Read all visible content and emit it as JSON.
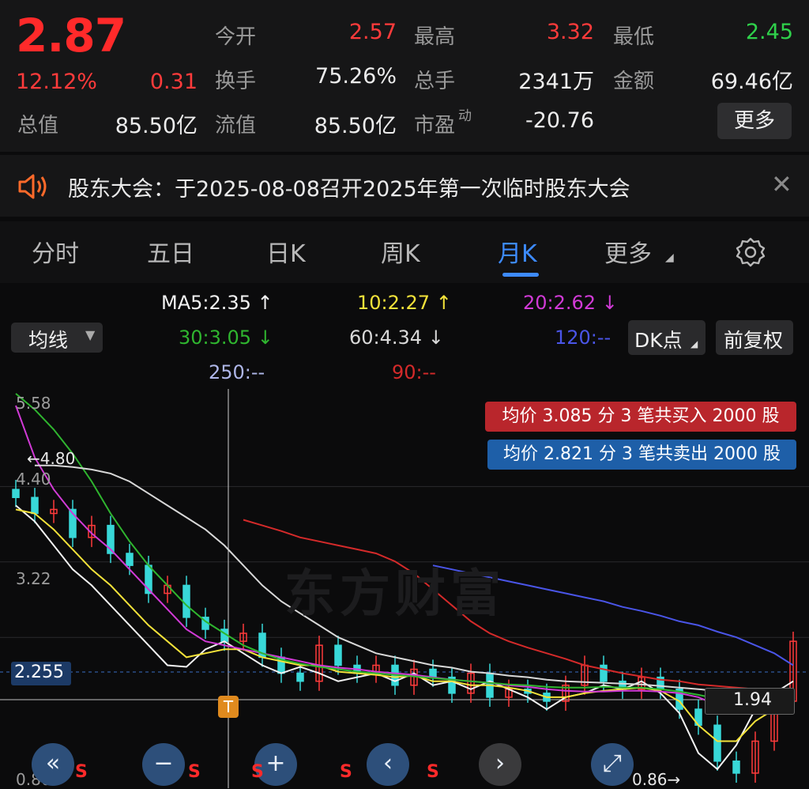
{
  "quote": {
    "price": "2.87",
    "change_pct": "12.12%",
    "change": "0.31",
    "rows": [
      [
        {
          "label": "今开",
          "value": "2.57",
          "tone": "up"
        },
        {
          "label": "最高",
          "value": "3.32",
          "tone": "up"
        },
        {
          "label": "最低",
          "value": "2.45",
          "tone": "dn"
        }
      ],
      [
        {
          "label": "换手",
          "value": "75.26%",
          "tone": ""
        },
        {
          "label": "总手",
          "value": "2341万",
          "tone": ""
        },
        {
          "label": "金额",
          "value": "69.46亿",
          "tone": ""
        }
      ],
      [
        {
          "label": "总值",
          "value": "85.50亿",
          "tone": ""
        },
        {
          "label": "流值",
          "value": "85.50亿",
          "tone": ""
        },
        {
          "label": "市盈",
          "sup": "动",
          "value": "-20.76",
          "tone": ""
        }
      ]
    ],
    "more_label": "更多"
  },
  "notice": {
    "text": "股东大会：于2025-08-08召开2025年第一次临时股东大会",
    "icon": "speaker-icon"
  },
  "tabs": [
    {
      "label": "分时",
      "active": false
    },
    {
      "label": "五日",
      "active": false
    },
    {
      "label": "日K",
      "active": false
    },
    {
      "label": "周K",
      "active": false
    },
    {
      "label": "月K",
      "active": true
    },
    {
      "label": "更多",
      "active": false
    }
  ],
  "settings_icon": "gear-icon",
  "ma_selector": "均线",
  "ma_legend": [
    {
      "text": "MA5:2.35 ↑",
      "color": "#f2f2f2"
    },
    {
      "text": "10:2.27 ↑",
      "color": "#f3e23a"
    },
    {
      "text": "20:2.62 ↓",
      "color": "#d13ad6"
    },
    {
      "text": "30:3.05 ↓",
      "color": "#2fb52f"
    },
    {
      "text": "60:4.34 ↓",
      "color": "#d8d8d8"
    },
    {
      "text": "120:--",
      "color": "#4a55e8"
    },
    {
      "text": "250:--",
      "color": "#aeb6e8"
    },
    {
      "text": "90:--",
      "color": "#d42a2a"
    }
  ],
  "dk_button": "DK点",
  "fq_button": "前复权",
  "chart_notes": {
    "buy": "均价 3.085 分 3 笔共买入 2000 股",
    "sell": "均价 2.821 分 3 笔共卖出 2000 股"
  },
  "watermark": "东方财富",
  "chart_data": {
    "type": "line",
    "y_labels": [
      "5.58",
      "4.40",
      "3.22",
      "2.255",
      "0.86"
    ],
    "max_label": "4.80",
    "min_label": "0.86",
    "cursor_value": "2.255",
    "right_value": "1.94",
    "t_marker": "T",
    "s_marks": [
      "S",
      "S",
      "S",
      "S",
      "S"
    ],
    "series": [
      {
        "color": "#f2f2f2",
        "values": [
          4.3,
          4.1,
          3.8,
          3.5,
          3.3,
          3.05,
          2.8,
          2.55,
          2.3,
          2.28,
          2.5,
          2.6,
          2.45,
          2.3,
          2.2,
          2.28,
          2.2,
          2.1,
          2.15,
          2.2,
          2.1,
          2.2,
          2.05,
          2.1,
          2.0,
          2.1,
          2.0,
          1.9,
          1.75,
          1.9,
          1.95,
          2.05,
          2.0,
          2.1,
          1.95,
          1.7,
          1.2,
          1.0,
          1.3,
          1.75,
          1.95,
          2.1
        ]
      },
      {
        "color": "#f3e23a",
        "values": [
          4.25,
          4.2,
          4.0,
          3.75,
          3.5,
          3.3,
          3.05,
          2.8,
          2.6,
          2.4,
          2.45,
          2.5,
          2.5,
          2.4,
          2.35,
          2.3,
          2.3,
          2.22,
          2.2,
          2.18,
          2.15,
          2.17,
          2.1,
          2.1,
          2.05,
          2.05,
          2.02,
          1.98,
          1.9,
          1.9,
          1.95,
          1.98,
          2.0,
          2.02,
          1.98,
          1.85,
          1.55,
          1.35,
          1.35,
          1.6,
          1.75,
          1.9
        ]
      },
      {
        "color": "#d13ad6",
        "values": [
          5.55,
          4.9,
          4.5,
          4.2,
          3.95,
          3.75,
          3.5,
          3.25,
          3.0,
          2.75,
          2.6,
          2.55,
          2.5,
          2.45,
          2.4,
          2.35,
          2.3,
          2.27,
          2.25,
          2.22,
          2.2,
          2.18,
          2.15,
          2.12,
          2.1,
          2.08,
          2.05,
          2.03,
          2.0,
          1.98,
          1.97,
          1.97,
          1.98,
          1.98,
          1.97,
          1.95,
          1.9,
          1.8,
          1.72,
          1.72,
          1.75,
          1.72
        ]
      },
      {
        "color": "#2fb52f",
        "values": [
          5.7,
          5.5,
          5.25,
          4.95,
          4.6,
          4.2,
          3.85,
          3.55,
          3.3,
          3.05,
          2.85,
          2.7,
          2.55,
          2.45,
          2.37,
          2.32,
          2.28,
          2.25,
          2.22,
          2.2,
          2.18,
          2.16,
          2.14,
          2.12,
          2.1,
          2.08,
          2.06,
          2.05,
          2.03,
          2.02,
          2.02,
          2.03,
          2.02,
          2.02,
          2.0,
          1.97,
          1.93,
          1.88,
          1.82,
          1.8,
          1.8,
          1.8
        ]
      },
      {
        "color": "#d8d8d8",
        "values": [
          null,
          4.8,
          4.8,
          4.78,
          4.75,
          4.7,
          4.6,
          4.45,
          4.3,
          4.15,
          4.0,
          3.8,
          3.55,
          3.3,
          3.1,
          2.95,
          2.8,
          2.65,
          2.55,
          2.45,
          2.4,
          2.35,
          2.3,
          2.27,
          2.22,
          2.2,
          2.17,
          2.15,
          2.12,
          2.1,
          2.09,
          2.08,
          2.07,
          2.06,
          2.04,
          2.02,
          2.0,
          1.98,
          1.96,
          1.95,
          null,
          null
        ]
      },
      {
        "color": "#d42a2a",
        "values": [
          null,
          null,
          null,
          null,
          null,
          null,
          null,
          null,
          null,
          null,
          null,
          null,
          4.12,
          4.05,
          3.98,
          3.9,
          3.85,
          3.8,
          3.75,
          3.7,
          3.6,
          3.45,
          3.25,
          3.05,
          2.85,
          2.7,
          2.6,
          2.52,
          2.45,
          2.38,
          2.3,
          2.25,
          2.2,
          2.16,
          2.12,
          2.1,
          2.06,
          2.04,
          2.02,
          2.0,
          2.0,
          1.99
        ]
      },
      {
        "color": "#4a55e8",
        "values": [
          null,
          null,
          null,
          null,
          null,
          null,
          null,
          null,
          null,
          null,
          null,
          null,
          null,
          null,
          null,
          null,
          null,
          null,
          null,
          null,
          null,
          null,
          3.55,
          3.5,
          3.45,
          3.4,
          3.35,
          3.3,
          3.25,
          3.2,
          3.15,
          3.1,
          3.03,
          2.98,
          2.92,
          2.85,
          2.8,
          2.72,
          2.65,
          2.55,
          2.45,
          2.3
        ]
      }
    ],
    "candles": [
      4.4,
      4.2,
      4.25,
      3.9,
      4.05,
      3.7,
      3.55,
      3.2,
      3.3,
      2.9,
      2.75,
      2.6,
      2.7,
      2.4,
      2.2,
      2.1,
      2.55,
      2.3,
      2.2,
      2.3,
      2.05,
      2.25,
      2.15,
      1.95,
      2.2,
      1.9,
      2.0,
      1.95,
      1.85,
      2.05,
      2.3,
      2.1,
      2.0,
      2.15,
      2.0,
      1.75,
      1.55,
      1.1,
      0.95,
      1.35,
      1.85,
      2.6
    ]
  }
}
